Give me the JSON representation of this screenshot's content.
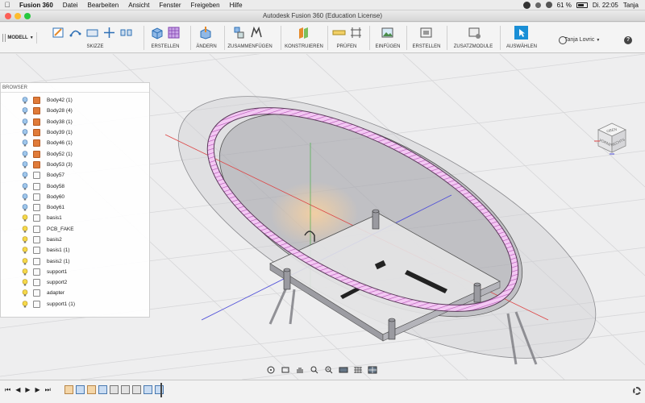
{
  "menubar": {
    "app_name": "Fusion 360",
    "items": [
      "Datei",
      "Bearbeiten",
      "Ansicht",
      "Fenster",
      "Freigeben",
      "Hilfe"
    ],
    "battery": "61 %",
    "clock": "Di. 22:05",
    "user": "Tanja"
  },
  "window": {
    "title": "Autodesk Fusion 360 (Education License)"
  },
  "toolbar": {
    "workspace": "MODELL",
    "groups": [
      "SKIZZE",
      "ERSTELLEN",
      "ÄNDERN",
      "ZUSAMMENFÜGEN",
      "KONSTRUIEREN",
      "PRÜFEN",
      "EINFÜGEN",
      "ERSTELLEN",
      "ZUSATZMODULE",
      "AUSWÄHLEN"
    ],
    "user_name": "Tanja Lovric",
    "help": "?"
  },
  "browser": {
    "title": "BROWSER",
    "items": [
      {
        "label": "Body42 (1)",
        "type": "body-orange"
      },
      {
        "label": "Body28 (4)",
        "type": "body-orange"
      },
      {
        "label": "Body38 (1)",
        "type": "body-orange"
      },
      {
        "label": "Body39 (1)",
        "type": "body-orange"
      },
      {
        "label": "Body46 (1)",
        "type": "body-orange"
      },
      {
        "label": "Body52 (1)",
        "type": "body-orange"
      },
      {
        "label": "Body53 (3)",
        "type": "body-orange"
      },
      {
        "label": "Body57",
        "type": "body-white"
      },
      {
        "label": "Body58",
        "type": "body-white"
      },
      {
        "label": "Body60",
        "type": "body-white"
      },
      {
        "label": "Body61",
        "type": "body-white"
      },
      {
        "label": "basis1",
        "type": "body-white"
      },
      {
        "label": "PCB_FAKE",
        "type": "body-white"
      },
      {
        "label": "basis2",
        "type": "body-white"
      },
      {
        "label": "basis1 (1)",
        "type": "body-white"
      },
      {
        "label": "basis2 (1)",
        "type": "body-white"
      },
      {
        "label": "support1",
        "type": "body-white"
      },
      {
        "label": "support2",
        "type": "body-white"
      },
      {
        "label": "adapter",
        "type": "body-white"
      },
      {
        "label": "support1 (1)",
        "type": "body-white"
      }
    ]
  },
  "viewcube": {
    "faces": [
      "OBEN",
      "VORNE",
      "RECHTS"
    ]
  },
  "colors": {
    "accent_blue": "#1a8fd6",
    "section_pink": "#e8a6e8",
    "body_orange": "#e07b39"
  }
}
